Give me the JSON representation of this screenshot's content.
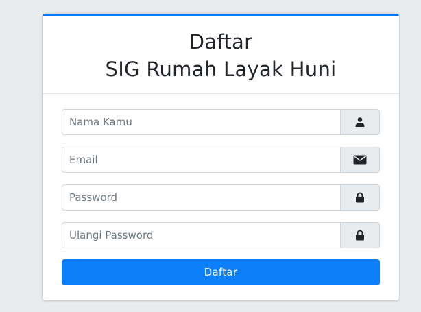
{
  "header": {
    "title_line1": "Daftar",
    "title_line2": "SIG Rumah Layak Huni"
  },
  "form": {
    "name": {
      "placeholder": "Nama Kamu",
      "icon": "user-icon"
    },
    "email": {
      "placeholder": "Email",
      "icon": "envelope-icon"
    },
    "password": {
      "placeholder": "Password",
      "icon": "lock-icon"
    },
    "password_confirm": {
      "placeholder": "Ulangi Password",
      "icon": "lock-icon"
    },
    "submit_label": "Daftar"
  },
  "colors": {
    "accent": "#007bff",
    "background": "#e9ecef",
    "addon_background": "#e9ecef",
    "icon": "#212529"
  }
}
